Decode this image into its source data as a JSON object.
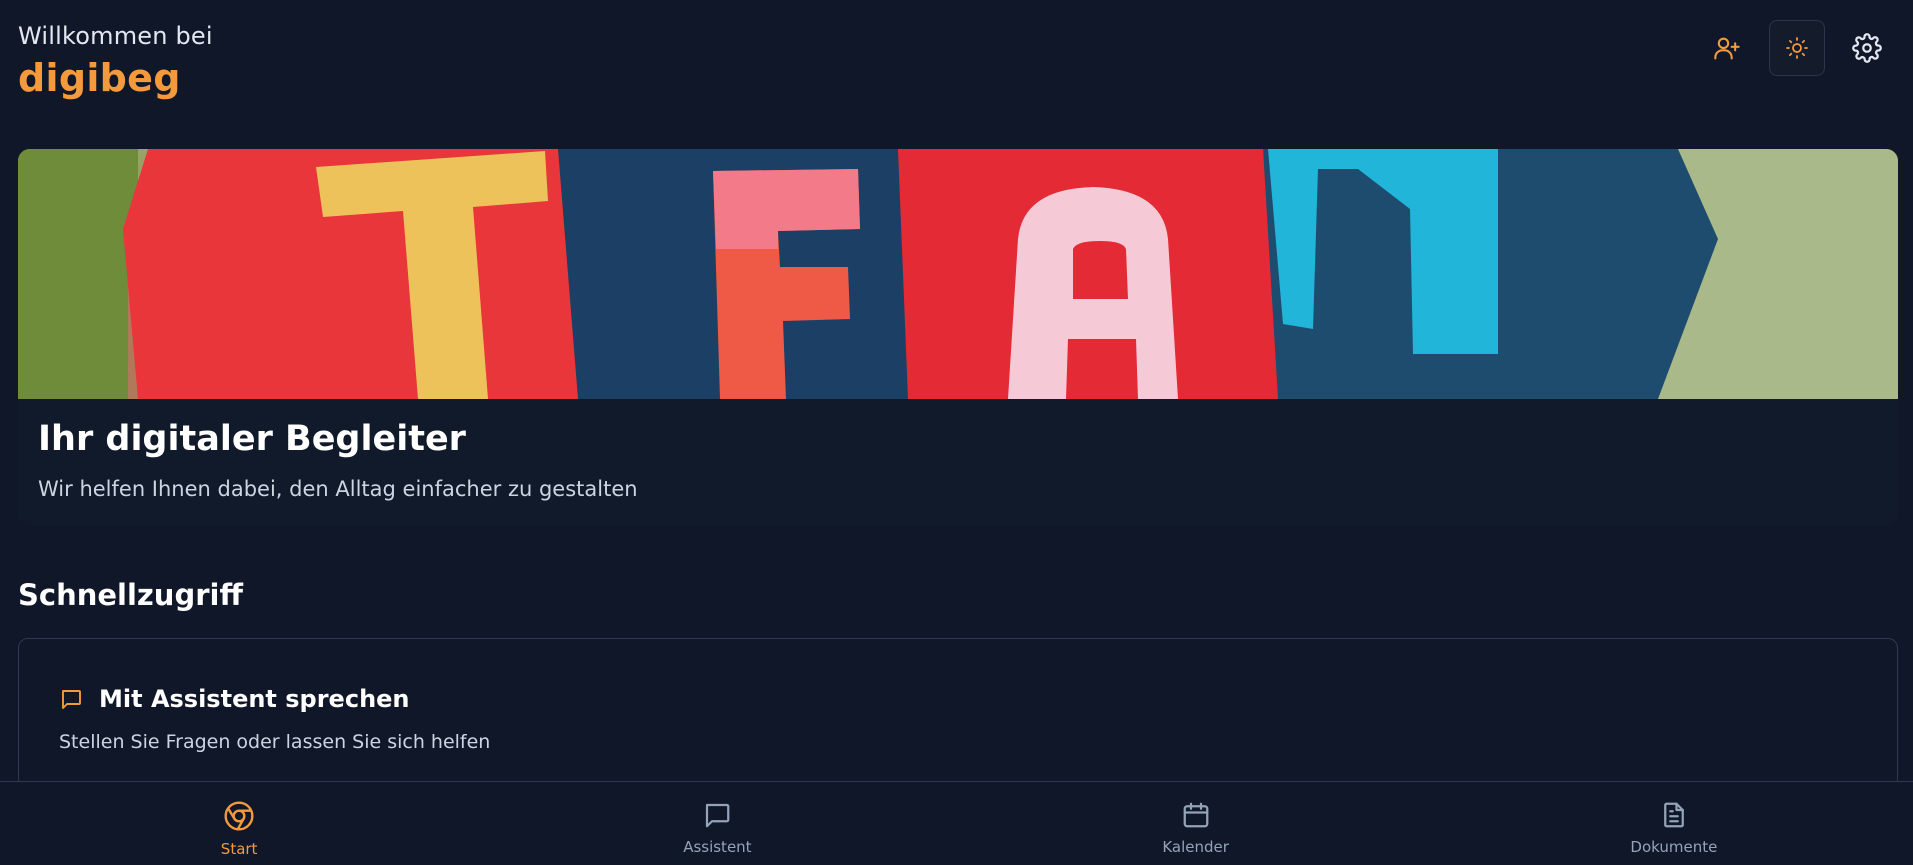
{
  "header": {
    "welcome": "Willkommen bei",
    "brand": "digibeg",
    "actions": [
      {
        "icon": "user-plus-icon",
        "label": "add-user"
      },
      {
        "icon": "sun-icon",
        "label": "theme-toggle"
      },
      {
        "icon": "gear-icon",
        "label": "settings"
      }
    ]
  },
  "hero": {
    "image_letters": [
      "T",
      "E",
      "A",
      "M"
    ],
    "title": "Ihr digitaler Begleiter",
    "subtitle": "Wir helfen Ihnen dabei, den Alltag einfacher zu gestalten"
  },
  "quick_access": {
    "title": "Schnellzugriff",
    "cards": [
      {
        "icon": "chat-icon",
        "title": "Mit Assistent sprechen",
        "subtitle": "Stellen Sie Fragen oder lassen Sie sich helfen"
      }
    ]
  },
  "nav": {
    "items": [
      {
        "label": "Start",
        "icon": "chrome-icon",
        "active": true
      },
      {
        "label": "Assistent",
        "icon": "chat-icon",
        "active": false
      },
      {
        "label": "Kalender",
        "icon": "calendar-icon",
        "active": false
      },
      {
        "label": "Dokumente",
        "icon": "document-icon",
        "active": false
      }
    ]
  },
  "colors": {
    "background": "#0f1729",
    "accent": "#f59a3c",
    "border": "#2f3a4c"
  }
}
